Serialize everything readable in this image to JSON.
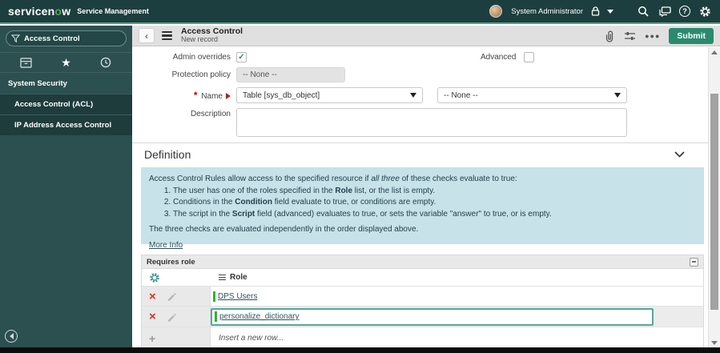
{
  "topbar": {
    "logo_pre": "servicen",
    "logo_o": "o",
    "logo_post": "w",
    "product": "Service Management",
    "user_name": "System Administrator"
  },
  "sidebar": {
    "search_value": "Access Control",
    "section_label": "System Security",
    "items": [
      {
        "label": "Access Control (ACL)"
      },
      {
        "label": "IP Address Access Control"
      }
    ]
  },
  "record_header": {
    "title": "Access Control",
    "subtitle": "New record",
    "submit_label": "Submit"
  },
  "form": {
    "admin_overrides_label": "Admin overrides",
    "advanced_label": "Advanced",
    "protection_policy_label": "Protection policy",
    "protection_policy_value": "-- None --",
    "name_label": "Name",
    "name_value": "Table [sys_db_object]",
    "name_operator_value": "-- None --",
    "description_label": "Description"
  },
  "definition": {
    "title": "Definition",
    "intro_pre": "Access Control Rules allow access to the specified resource if ",
    "intro_em": "all three",
    "intro_post": " of these checks evaluate to true:",
    "list": [
      {
        "pre": "The user has one of the roles specified in the ",
        "bold": "Role",
        "post": " list, or the list is empty."
      },
      {
        "pre": "Conditions in the ",
        "bold": "Condition",
        "post": " field evaluate to true, or conditions are empty."
      },
      {
        "pre": "The script in the ",
        "bold": "Script",
        "post": " field (advanced) evaluates to true, or sets the variable \"answer\" to true, or is empty."
      }
    ],
    "footer": "The three checks are evaluated independently in the order displayed above.",
    "more_info_label": "More Info"
  },
  "requires_role": {
    "title": "Requires role",
    "column_label": "Role",
    "rows": [
      {
        "role": "DPS Users"
      },
      {
        "role": "personalize_dictionary"
      }
    ],
    "insert_label": "Insert a new row..."
  },
  "colors": {
    "header_bg": "#1d3e3e",
    "sidebar_bg": "#2c4f4f",
    "sidebar_item_bg": "#1e3c3c",
    "accent_green_line": "#53a07d",
    "submit_green": "#2b8a6e",
    "info_box_bg": "#c7e2e8",
    "focus_border": "#56a79a",
    "delete_red": "#e0321c",
    "modified_indicator_green": "#2cb52c"
  }
}
